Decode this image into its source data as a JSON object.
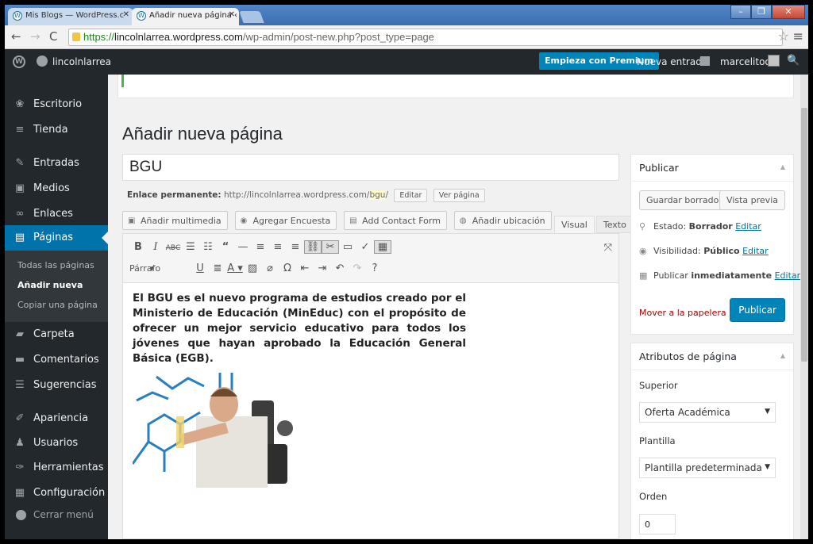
{
  "browser": {
    "tabs": [
      {
        "label": "Mis Blogs — WordPress.c"
      },
      {
        "label": "Añadir nueva página ‹ linc"
      }
    ],
    "url_scheme": "https://",
    "url_host": "lincolnlarrea.wordpress.com",
    "url_path": "/wp-admin/post-new.php?post_type=page"
  },
  "adminbar": {
    "site_name": "lincolnlarrea",
    "premium": "Empieza con Premium",
    "new_post": "Nueva entrada",
    "user": "marcelitooo"
  },
  "sidebar": {
    "items": [
      {
        "label": "Escritorio",
        "icon": "dashboard-icon",
        "glyph": "❀"
      },
      {
        "label": "Tienda",
        "icon": "cart-icon",
        "glyph": "🛒"
      },
      {
        "label": "Entradas",
        "icon": "pin-icon",
        "glyph": "✎"
      },
      {
        "label": "Medios",
        "icon": "media-icon",
        "glyph": "▣"
      },
      {
        "label": "Enlaces",
        "icon": "link-icon",
        "glyph": "∞"
      },
      {
        "label": "Páginas",
        "icon": "page-icon",
        "glyph": "▤"
      },
      {
        "label": "Carpeta",
        "icon": "folder-icon",
        "glyph": "▰"
      },
      {
        "label": "Comentarios",
        "icon": "comment-icon",
        "glyph": "▬"
      },
      {
        "label": "Sugerencias",
        "icon": "feedback-icon",
        "glyph": "☰"
      },
      {
        "label": "Apariencia",
        "icon": "brush-icon",
        "glyph": "✐"
      },
      {
        "label": "Usuarios",
        "icon": "users-icon",
        "glyph": "♟"
      },
      {
        "label": "Herramientas",
        "icon": "wrench-icon",
        "glyph": "✑"
      },
      {
        "label": "Configuración",
        "icon": "settings-icon",
        "glyph": "▦"
      }
    ],
    "submenu": [
      "Todas las páginas",
      "Añadir nueva",
      "Copiar una página"
    ],
    "collapse": "Cerrar menú"
  },
  "main": {
    "title": "Añadir nueva página",
    "post_title": "BGU",
    "permalink_label": "Enlace permanente:",
    "permalink_base": "http://lincolnlarrea.wordpress.com/",
    "permalink_slug": "bgu",
    "permalink_end": "/",
    "edit_btn": "Editar",
    "view_btn": "Ver página",
    "media_buttons": [
      "Añadir multimedia",
      "Agregar Encuesta",
      "Add Contact Form",
      "Añadir ubicación"
    ],
    "tab_visual": "Visual",
    "tab_text": "Texto",
    "format": "Párrafo",
    "body_text": "El BGU es el nuevo programa de estudios creado por el Ministerio de Educación (MinEduc) con el propósito de ofrecer un mejor servicio educativo para todos los jóvenes que hayan aprobado la Educación General Básica (EGB)."
  },
  "publish": {
    "title": "Publicar",
    "save_draft": "Guardar borrador",
    "preview": "Vista previa",
    "status_label": "Estado:",
    "status_value": "Borrador",
    "visibility_label": "Visibilidad:",
    "visibility_value": "Público",
    "schedule_label": "Publicar",
    "schedule_value": "inmediatamente",
    "edit_link": "Editar",
    "trash": "Mover a la papelera",
    "publish_btn": "Publicar"
  },
  "attributes": {
    "title": "Atributos de página",
    "parent_label": "Superior",
    "parent_value": "Oferta Académica",
    "template_label": "Plantilla",
    "template_value": "Plantilla predeterminada",
    "order_label": "Orden",
    "order_value": "0"
  }
}
